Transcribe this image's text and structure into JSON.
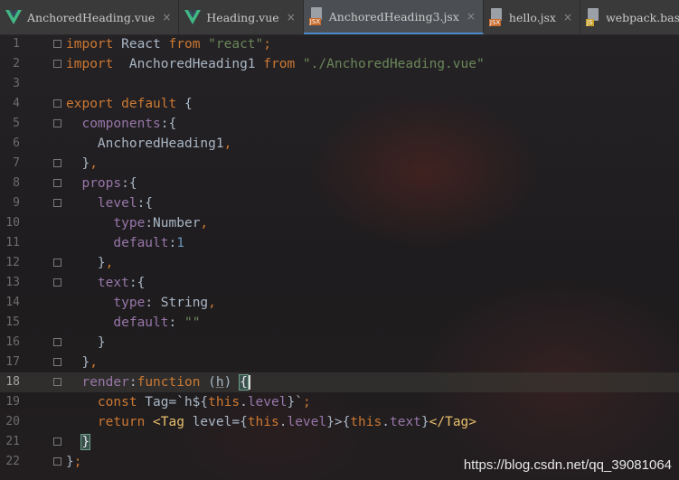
{
  "tabs": [
    {
      "label": "AnchoredHeading.vue",
      "icon": "vue-icon",
      "active": false
    },
    {
      "label": "Heading.vue",
      "icon": "vue-icon",
      "active": false
    },
    {
      "label": "AnchoredHeading3.jsx",
      "icon": "jsx-file-icon",
      "active": true
    },
    {
      "label": "hello.jsx",
      "icon": "jsx-file-icon",
      "active": false
    },
    {
      "label": "webpack.base.conf.js",
      "icon": "js-file-icon",
      "active": false
    }
  ],
  "file_badges": {
    "jsx": "JSX",
    "js": "JS"
  },
  "close_glyph": "×",
  "line_numbers": [
    "1",
    "2",
    "3",
    "4",
    "5",
    "6",
    "7",
    "8",
    "9",
    "10",
    "11",
    "12",
    "13",
    "14",
    "15",
    "16",
    "17",
    "18",
    "19",
    "20",
    "21",
    "22"
  ],
  "current_line": 18,
  "watermark": "https://blog.csdn.net/qq_39081064",
  "colors": {
    "keyword": "#cc7832",
    "string": "#6a8759",
    "number": "#6897bb",
    "property": "#9876aa",
    "plain": "#a9b7c6",
    "jsx_tag": "#e8bf6a"
  },
  "code": {
    "l1": {
      "t1": "import",
      "t2": " React ",
      "t3": "from",
      "t4": " ",
      "t5": "\"react\"",
      "t6": ";"
    },
    "l2": {
      "t1": "import",
      "t2": "  AnchoredHeading1 ",
      "t3": "from",
      "t4": " ",
      "t5": "\"./AnchoredHeading.vue\""
    },
    "l4": {
      "t1": "export",
      "t2": " ",
      "t3": "default",
      "t4": " {"
    },
    "l5": {
      "t1": "  ",
      "t2": "components",
      "t3": ":{"
    },
    "l6": {
      "t1": "    AnchoredHeading1",
      "t2": ","
    },
    "l7": {
      "t1": "  }",
      "t2": ","
    },
    "l8": {
      "t1": "  ",
      "t2": "props",
      "t3": ":{"
    },
    "l9": {
      "t1": "    ",
      "t2": "level",
      "t3": ":{"
    },
    "l10": {
      "t1": "      ",
      "t2": "type",
      "t3": ":Number",
      "t4": ","
    },
    "l11": {
      "t1": "      ",
      "t2": "default",
      "t3": ":",
      "t4": "1"
    },
    "l12": {
      "t1": "    }",
      "t2": ","
    },
    "l13": {
      "t1": "    ",
      "t2": "text",
      "t3": ":{"
    },
    "l14": {
      "t1": "      ",
      "t2": "type",
      "t3": ": String",
      "t4": ","
    },
    "l15": {
      "t1": "      ",
      "t2": "default",
      "t3": ": ",
      "t4": "\"\""
    },
    "l16": {
      "t1": "    }"
    },
    "l17": {
      "t1": "  }",
      "t2": ","
    },
    "l18": {
      "t1": "  ",
      "t2": "render",
      "t3": ":",
      "t4": "function",
      "t5": " (",
      "t6": "h",
      "t7": ") ",
      "t8": "{"
    },
    "l19": {
      "t1": "    ",
      "t2": "const",
      "t3": " Tag=`h${",
      "t4": "this",
      "t5": ".",
      "t6": "level",
      "t7": "}`",
      "t8": ";"
    },
    "l20": {
      "t1": "    ",
      "t2": "return",
      "t3": " ",
      "t4": "<Tag",
      "t5": " level={",
      "t6": "this",
      "t7": ".",
      "t8": "level",
      "t9": "}>{",
      "t10": "this",
      "t11": ".",
      "t12": "text",
      "t13": "}",
      "t14": "</Tag>"
    },
    "l21": {
      "t1": "  ",
      "t2": "}"
    },
    "l22": {
      "t1": "}",
      "t2": ";"
    }
  }
}
